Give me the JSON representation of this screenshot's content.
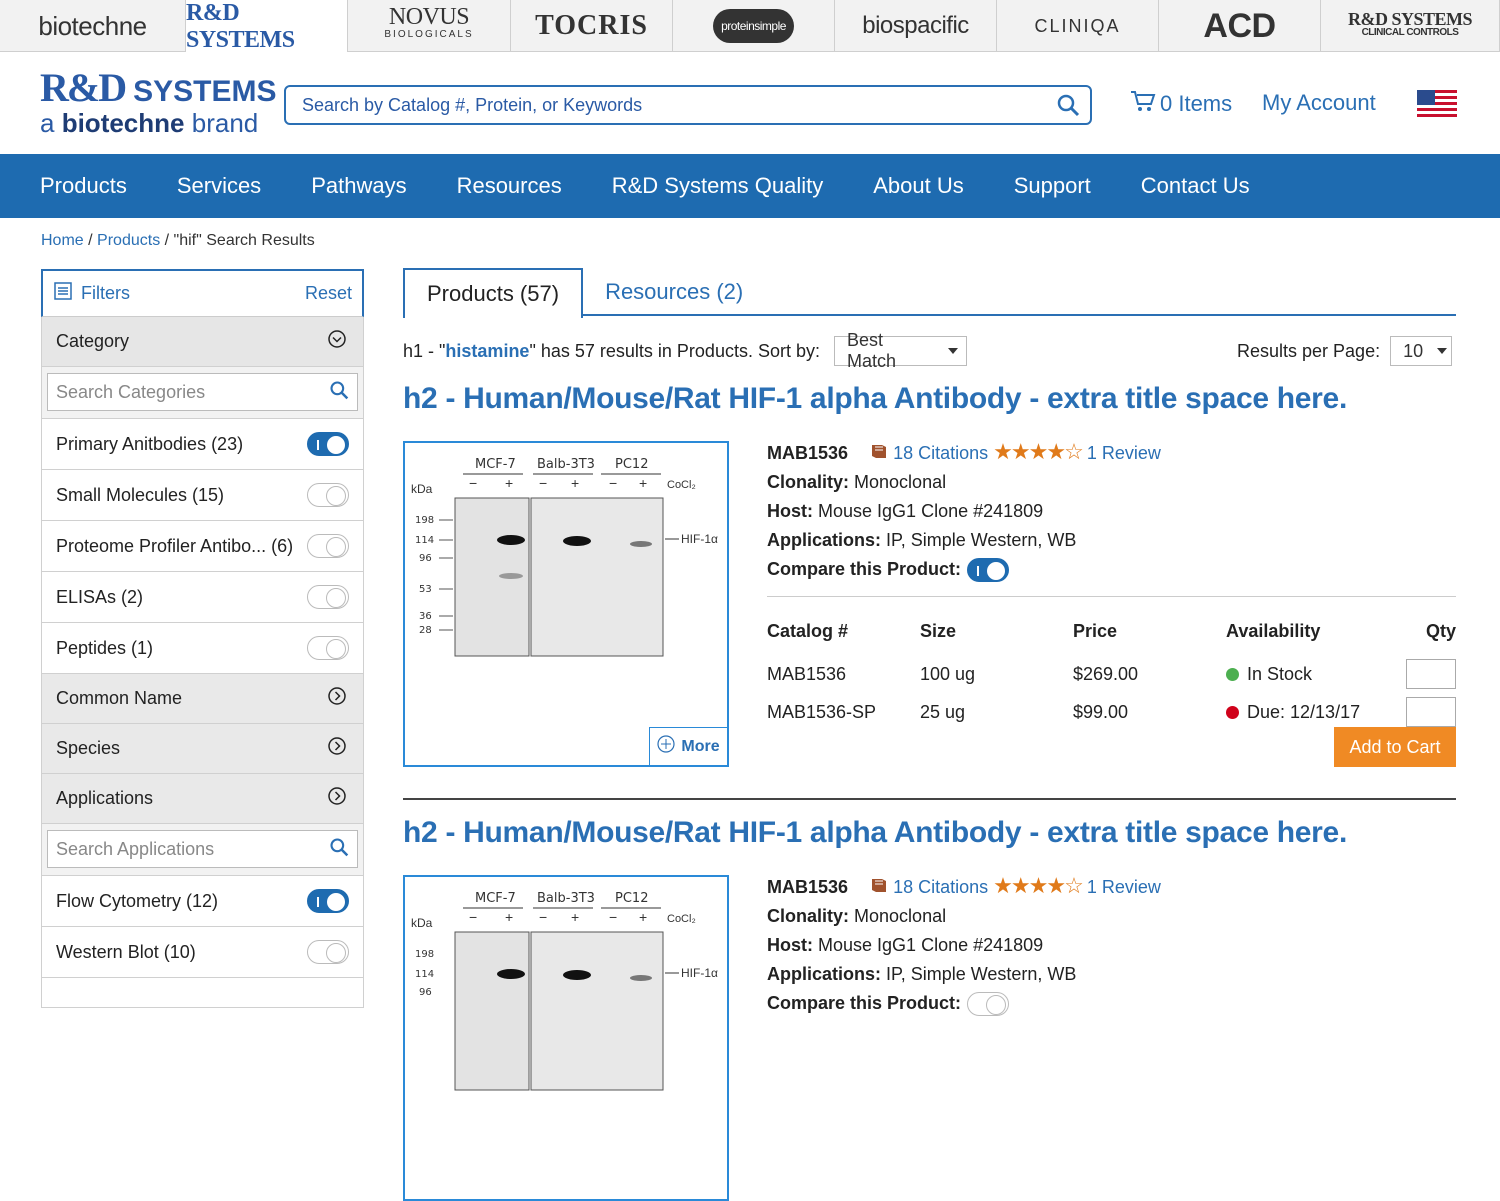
{
  "brands": [
    "biotechne",
    "R&D SYSTEMS",
    "NOVUS",
    "TOCRIS",
    "proteinsimple",
    "biospacific",
    "CLINIQA",
    "ACD",
    "R&D SYSTEMS CLINICAL CONTROLS"
  ],
  "brand_sub": {
    "novus": "BIOLOGICALS",
    "clinical": "CLINICAL CONTROLS"
  },
  "logo": {
    "main": "R&D",
    "systems": "SYSTEMS",
    "tagline_a": "a",
    "tagline_brand": "biotechne",
    "tagline_end": "brand"
  },
  "search": {
    "placeholder": "Search by Catalog #, Protein, or Keywords"
  },
  "cart": {
    "label": "0 Items"
  },
  "account": {
    "label": "My Account"
  },
  "nav": [
    "Products",
    "Services",
    "Pathways",
    "Resources",
    "R&D Systems Quality",
    "About Us",
    "Support",
    "Contact Us"
  ],
  "breadcrumb": {
    "home": "Home",
    "products": "Products",
    "current": "\"hif\" Search Results",
    "sep": "/"
  },
  "filters": {
    "title": "Filters",
    "reset": "Reset",
    "category": "Category",
    "search_categories": "Search Categories",
    "category_items": [
      {
        "label": "Primary Anitbodies (23)",
        "on": true
      },
      {
        "label": "Small Molecules (15)",
        "on": false
      },
      {
        "label": "Proteome Profiler Antibo... (6)",
        "on": false
      },
      {
        "label": "ELISAs (2)",
        "on": false
      },
      {
        "label": "Peptides (1)",
        "on": false
      }
    ],
    "common_name": "Common Name",
    "species": "Species",
    "applications": "Applications",
    "search_applications": "Search Applications",
    "app_items": [
      {
        "label": "Flow Cytometry (12)",
        "on": true
      },
      {
        "label": "Western Blot (10)",
        "on": false
      }
    ]
  },
  "tabs": {
    "products": "Products (57)",
    "resources": "Resources (2)"
  },
  "results": {
    "prefix": "h1 - \"",
    "keyword": "histamine",
    "suffix": "\" has 57 results in Products. Sort by:",
    "sort_value": "Best Match",
    "rpp_label": "Results per Page:",
    "rpp_value": "10"
  },
  "products": [
    {
      "title": "h2 - Human/Mouse/Rat HIF-1 alpha Antibody - extra title space here.",
      "catalog": "MAB1536",
      "citations": "18 Citations",
      "stars": "★★★★☆",
      "reviews": "1 Review",
      "clonality_label": "Clonality:",
      "clonality": "Monoclonal",
      "host_label": "Host:",
      "host": "Mouse IgG1 Clone #241809",
      "apps_label": "Applications:",
      "apps": "IP, Simple Western, WB",
      "compare_label": "Compare this Product:",
      "more": "More",
      "blot": {
        "lanes": [
          "MCF-7",
          "Balb-3T3",
          "PC12"
        ],
        "kda": "kDa",
        "markers": [
          "198",
          "114",
          "96",
          "53",
          "36",
          "28"
        ],
        "band": "HIF-1α",
        "treat": "CoCl₂",
        "signs": [
          "−",
          "+",
          "−",
          "+",
          "−",
          "+"
        ]
      },
      "table_head": [
        "Catalog #",
        "Size",
        "Price",
        "Availability",
        "Qty"
      ],
      "rows": [
        {
          "cat": "MAB1536",
          "size": "100 ug",
          "price": "$269.00",
          "avail": "In Stock",
          "status_color": "#4caf50"
        },
        {
          "cat": "MAB1536-SP",
          "size": "25 ug",
          "price": "$99.00",
          "avail": "Due: 12/13/17",
          "status_color": "#d0021b"
        }
      ],
      "add_to_cart": "Add to Cart"
    },
    {
      "title": "h2 - Human/Mouse/Rat HIF-1 alpha Antibody - extra title space here.",
      "catalog": "MAB1536",
      "citations": "18 Citations",
      "stars": "★★★★☆",
      "reviews": "1 Review",
      "clonality_label": "Clonality:",
      "clonality": "Monoclonal",
      "host_label": "Host:",
      "host": "Mouse IgG1 Clone #241809",
      "apps_label": "Applications:",
      "apps": "IP, Simple Western, WB",
      "compare_label": "Compare this Product:"
    }
  ],
  "colors": {
    "brand_blue": "#2a6fb4",
    "nav_bg": "#1e6bb0",
    "accent_orange": "#f08a24",
    "star": "#e07a1a"
  }
}
